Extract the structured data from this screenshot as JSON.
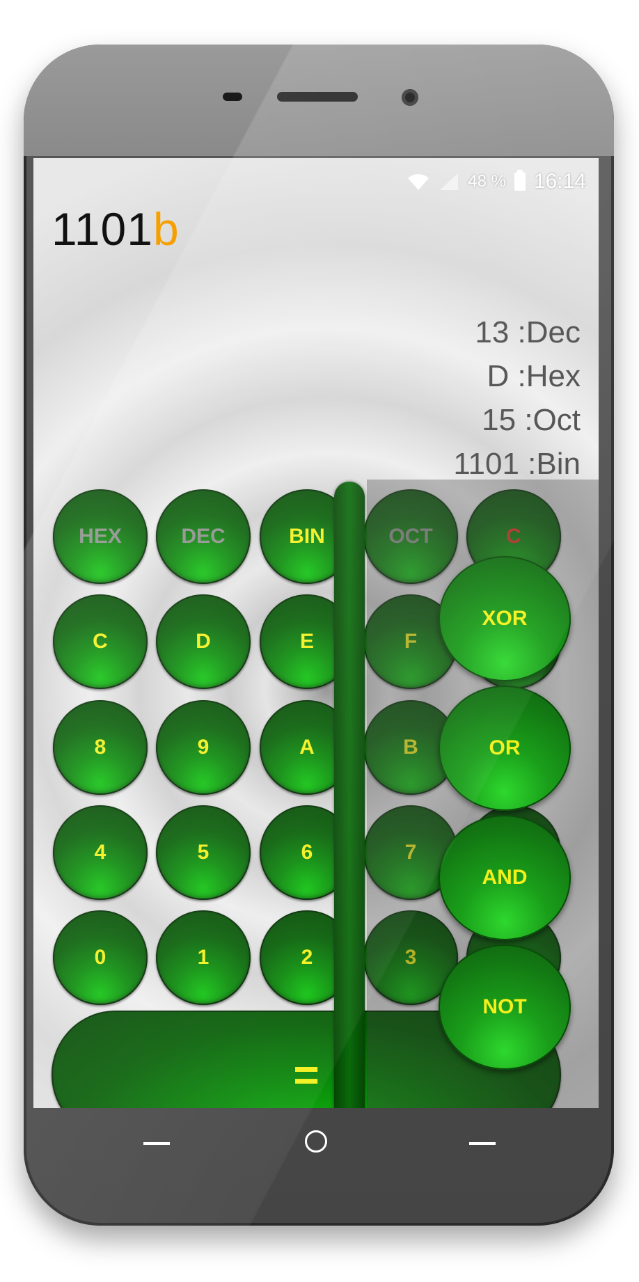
{
  "status_bar": {
    "battery_percent": "48 %",
    "time": "16:14",
    "icons": [
      "wifi-icon",
      "signal-icon",
      "battery-icon"
    ]
  },
  "display": {
    "value": "1101",
    "suffix": "b"
  },
  "conversions": [
    {
      "text": "13 :Dec"
    },
    {
      "text": "D :Hex"
    },
    {
      "text": "15 :Oct"
    },
    {
      "text": "1101 :Bin"
    }
  ],
  "keypad": {
    "row1": [
      "HEX",
      "DEC",
      "BIN",
      "OCT",
      "C"
    ],
    "row2": [
      "C",
      "D",
      "E",
      "F"
    ],
    "row3": [
      "8",
      "9",
      "A",
      "B"
    ],
    "row4": [
      "4",
      "5",
      "6",
      "7"
    ],
    "row5": [
      "0",
      "1",
      "2",
      "3",
      "/"
    ],
    "equals": "="
  },
  "logic_ops": [
    "XOR",
    "OR",
    "AND",
    "NOT"
  ],
  "colors": {
    "button_text": "#f3f01b",
    "button_text_dim": "#8a8f8a",
    "clear_text": "#e03020",
    "suffix": "#f5a000",
    "button_green": "#0a8a0a"
  }
}
